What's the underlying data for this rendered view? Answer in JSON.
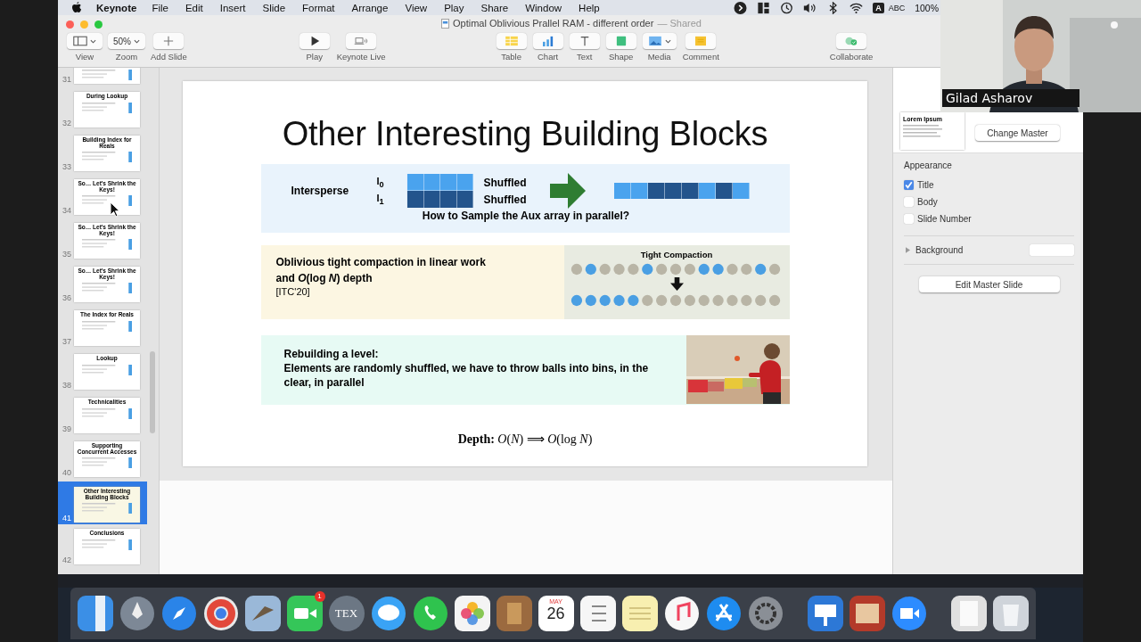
{
  "menubar": {
    "app": "Keynote",
    "menus": [
      "File",
      "Edit",
      "Insert",
      "Slide",
      "Format",
      "Arrange",
      "View",
      "Play",
      "Share",
      "Window",
      "Help"
    ],
    "input_badge": "A",
    "input": "ABC",
    "battery": "100%"
  },
  "window": {
    "title": "Optimal Oblivious Prallel RAM - different order",
    "title_suffix": "— Shared"
  },
  "toolbar": {
    "groups": [
      [
        {
          "kind": "view",
          "label": "View"
        },
        {
          "kind": "zoom",
          "label": "Zoom",
          "value": "50%"
        },
        {
          "kind": "add",
          "label": "Add Slide"
        }
      ],
      [
        {
          "kind": "play",
          "label": "Play"
        },
        {
          "kind": "live",
          "label": "Keynote Live"
        }
      ],
      [
        {
          "kind": "table",
          "label": "Table"
        },
        {
          "kind": "chart",
          "label": "Chart"
        },
        {
          "kind": "text",
          "label": "Text"
        },
        {
          "kind": "shape",
          "label": "Shape"
        },
        {
          "kind": "media",
          "label": "Media"
        },
        {
          "kind": "comment",
          "label": "Comment"
        }
      ],
      [
        {
          "kind": "collaborate",
          "label": "Collaborate"
        }
      ]
    ]
  },
  "slides": [
    {
      "number": "31",
      "selected": false
    },
    {
      "number": "32",
      "title": "During Lookup",
      "selected": false
    },
    {
      "number": "33",
      "title": "Building Index for Reals",
      "selected": false
    },
    {
      "number": "34",
      "title": "So… Let's Shrink the Keys!",
      "selected": false
    },
    {
      "number": "35",
      "title": "So… Let's Shrink the Keys!",
      "selected": false
    },
    {
      "number": "36",
      "title": "So… Let's Shrink the Keys!",
      "selected": false
    },
    {
      "number": "37",
      "title": "The Index for Reals",
      "selected": false
    },
    {
      "number": "38",
      "title": "Lookup",
      "selected": false
    },
    {
      "number": "39",
      "title": "Technicalities",
      "selected": false
    },
    {
      "number": "40",
      "title": "Supporting Concurrent Accesses",
      "selected": false
    },
    {
      "number": "41",
      "title": "Other Interesting Building Blocks",
      "selected": true
    },
    {
      "number": "42",
      "title": "Conclusions",
      "selected": false
    }
  ],
  "slide": {
    "title": "Other Interesting Building Blocks",
    "intersperse": {
      "label": "Intersperse",
      "rows": [
        {
          "label": "I$_{0}$",
          "text": "Shuffled"
        },
        {
          "label": "I$_{1}$",
          "text": "Shuffled"
        }
      ],
      "merged": [
        {
          "color": "#4aa3ee"
        },
        {
          "color": "#4aa3ee"
        },
        {
          "color": "#23548c"
        },
        {
          "color": "#23548c"
        },
        {
          "color": "#23548c"
        },
        {
          "color": "#4aa3ee"
        },
        {
          "color": "#23548c"
        },
        {
          "color": "#4aa3ee"
        }
      ],
      "caption": "How to Sample the Aux array in parallel?"
    },
    "compaction": {
      "lines": [
        "Oblivious tight compaction in linear work",
        "and *O*(log *N*) depth",
        "[ITC'20]"
      ],
      "diagram_title": "Tight Compaction",
      "before": [
        {
          "color": "#b9b5a6"
        },
        {
          "color": "#4a9fe3"
        },
        {
          "color": "#b9b5a6"
        },
        {
          "color": "#b9b5a6"
        },
        {
          "color": "#b9b5a6"
        },
        {
          "color": "#4a9fe3"
        },
        {
          "color": "#b9b5a6"
        },
        {
          "color": "#b9b5a6"
        },
        {
          "color": "#b9b5a6"
        },
        {
          "color": "#4a9fe3"
        },
        {
          "color": "#4a9fe3"
        },
        {
          "color": "#b9b5a6"
        },
        {
          "color": "#b9b5a6"
        },
        {
          "color": "#4a9fe3"
        },
        {
          "color": "#b9b5a6"
        }
      ],
      "after": [
        {
          "color": "#4a9fe3"
        },
        {
          "color": "#4a9fe3"
        },
        {
          "color": "#4a9fe3"
        },
        {
          "color": "#4a9fe3"
        },
        {
          "color": "#4a9fe3"
        },
        {
          "color": "#b9b5a6"
        },
        {
          "color": "#b9b5a6"
        },
        {
          "color": "#b9b5a6"
        },
        {
          "color": "#b9b5a6"
        },
        {
          "color": "#b9b5a6"
        },
        {
          "color": "#b9b5a6"
        },
        {
          "color": "#b9b5a6"
        },
        {
          "color": "#b9b5a6"
        },
        {
          "color": "#b9b5a6"
        },
        {
          "color": "#b9b5a6"
        }
      ]
    },
    "rebuild": {
      "heading": "Rebuilding a level:",
      "text": "Elements are randomly shuffled, we have to throw balls into bins, in the clear, in parallel"
    },
    "depth": "**Depth:** *O*(*N*) ⟹ *O*(log *N*)"
  },
  "inspector": {
    "layout_text": "Lorem Ipsum",
    "change_master": "Change Master",
    "appearance": "Appearance",
    "options": [
      {
        "label": "Title",
        "checked": true
      },
      {
        "label": "Body",
        "checked": false
      },
      {
        "label": "Slide Number",
        "checked": false
      }
    ],
    "background": "Background",
    "edit_master": "Edit Master Slide"
  },
  "webcam": {
    "name": "Gilad Asharov"
  },
  "dock": {
    "facetime_badge": "1",
    "tex_label": "TEX",
    "calendar_month": "MAY",
    "calendar_day": "26"
  }
}
